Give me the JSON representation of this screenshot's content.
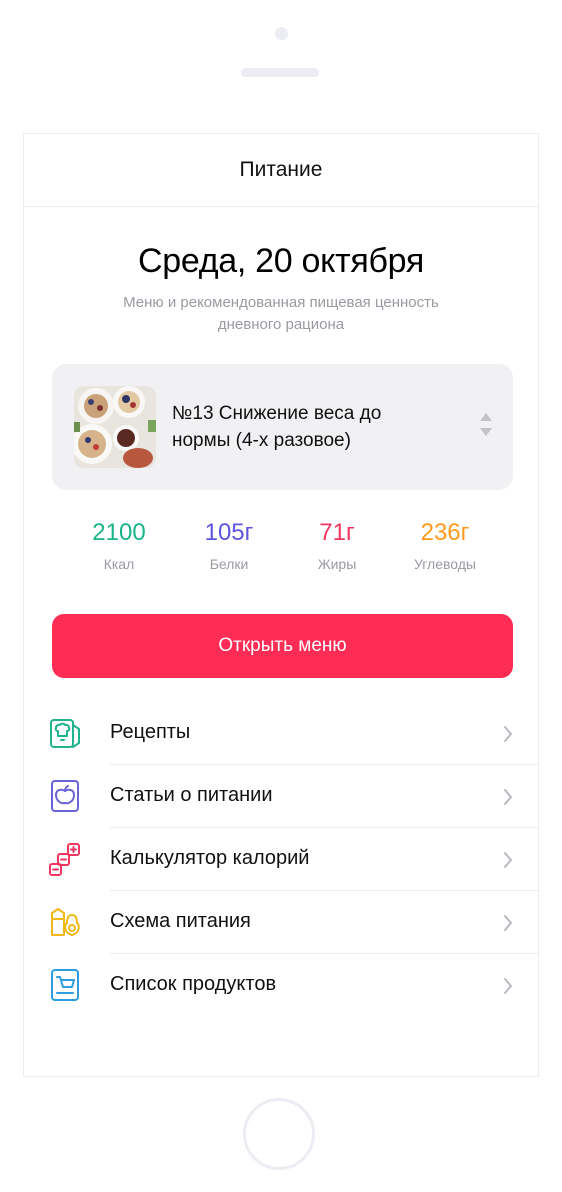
{
  "device": {
    "camera": "front-camera",
    "speaker": "earpiece-speaker",
    "home_button": "home-button"
  },
  "header": {
    "title": "Питание"
  },
  "day": {
    "title": "Среда, 20 октября",
    "subtitle": "Меню и рекомендованная пищевая ценность дневного рациона"
  },
  "diet": {
    "name": "№13 Снижение веса до нормы (4-х разовое)",
    "image": "food-photo",
    "selector_icon": "up-down-arrows-icon"
  },
  "stats": [
    {
      "value": "2100",
      "label": "Ккал",
      "color": "#19b48a"
    },
    {
      "value": "105г",
      "label": "Белки",
      "color": "#5b55e0"
    },
    {
      "value": "71г",
      "label": "Жиры",
      "color": "#f2365f"
    },
    {
      "value": "236г",
      "label": "Углеводы",
      "color": "#ff9a1f"
    }
  ],
  "open_menu": {
    "label": "Открыть меню",
    "color": "#ff2c55"
  },
  "menu": [
    {
      "label": "Рецепты",
      "icon": "recipe-book-icon",
      "color": "#20b38d"
    },
    {
      "label": "Статьи о питании",
      "icon": "apple-article-icon",
      "color": "#6b63d8"
    },
    {
      "label": "Калькулятор калорий",
      "icon": "calorie-calculator-icon",
      "color": "#f2365f"
    },
    {
      "label": "Схема питания",
      "icon": "food-scheme-icon",
      "color": "#f2b817"
    },
    {
      "label": "Список продуктов",
      "icon": "shopping-list-icon",
      "color": "#2f9de2"
    }
  ]
}
